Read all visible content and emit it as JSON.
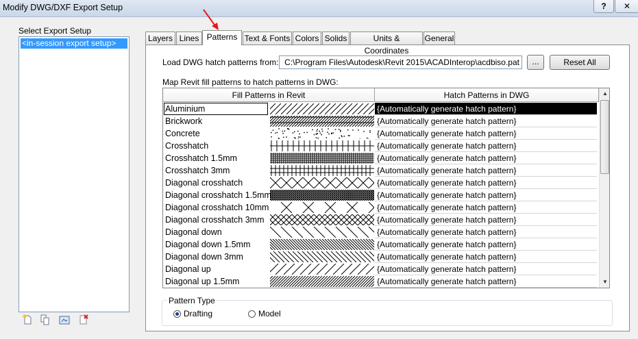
{
  "window": {
    "title": "Modify DWG/DXF Export Setup",
    "help_label": "?",
    "close_label": "✕"
  },
  "left_panel": {
    "label": "Select Export Setup",
    "items": [
      "<in-session export setup>"
    ]
  },
  "tabs": [
    "Layers",
    "Lines",
    "Patterns",
    "Text & Fonts",
    "Colors",
    "Solids",
    "Units & Coordinates",
    "General"
  ],
  "active_tab": "Patterns",
  "patterns": {
    "load_label": "Load DWG hatch patterns from:",
    "path_value": "C:\\Program Files\\Autodesk\\Revit 2015\\ACADInterop\\acdbiso.pat",
    "browse_label": "...",
    "reset_label": "Reset All",
    "map_label": "Map Revit fill patterns to hatch patterns in DWG:",
    "col_revit": "Fill Patterns in Revit",
    "col_dwg": "Hatch Patterns in DWG",
    "rows": [
      {
        "name": "Aluminium",
        "hatch": "{Automatically generate hatch pattern}",
        "pattern": "diag-up-lines"
      },
      {
        "name": "Brickwork",
        "hatch": "{Automatically generate hatch pattern}",
        "pattern": "diag-up-dense"
      },
      {
        "name": "Concrete",
        "hatch": "{Automatically generate hatch pattern}",
        "pattern": "dots"
      },
      {
        "name": "Crosshatch",
        "hatch": "{Automatically generate hatch pattern}",
        "pattern": "grid"
      },
      {
        "name": "Crosshatch 1.5mm",
        "hatch": "{Automatically generate hatch pattern}",
        "pattern": "grid-fine"
      },
      {
        "name": "Crosshatch 3mm",
        "hatch": "{Automatically generate hatch pattern}",
        "pattern": "grid-med"
      },
      {
        "name": "Diagonal crosshatch",
        "hatch": "{Automatically generate hatch pattern}",
        "pattern": "diag-cross"
      },
      {
        "name": "Diagonal crosshatch 1.5mm",
        "hatch": "{Automatically generate hatch pattern}",
        "pattern": "diag-cross-fine"
      },
      {
        "name": "Diagonal crosshatch 10mm",
        "hatch": "{Automatically generate hatch pattern}",
        "pattern": "diag-cross-wide"
      },
      {
        "name": "Diagonal crosshatch 3mm",
        "hatch": "{Automatically generate hatch pattern}",
        "pattern": "diag-cross-med"
      },
      {
        "name": "Diagonal down",
        "hatch": "{Automatically generate hatch pattern}",
        "pattern": "diag-down"
      },
      {
        "name": "Diagonal down 1.5mm",
        "hatch": "{Automatically generate hatch pattern}",
        "pattern": "diag-down-fine"
      },
      {
        "name": "Diagonal down 3mm",
        "hatch": "{Automatically generate hatch pattern}",
        "pattern": "diag-down-med"
      },
      {
        "name": "Diagonal up",
        "hatch": "{Automatically generate hatch pattern}",
        "pattern": "diag-up"
      },
      {
        "name": "Diagonal up 1.5mm",
        "hatch": "{Automatically generate hatch pattern}",
        "pattern": "diag-up-fine"
      }
    ],
    "selected_row": 0,
    "pattern_type": {
      "title": "Pattern Type",
      "options": [
        "Drafting",
        "Model"
      ],
      "selected": "Drafting"
    }
  },
  "left_tools": [
    "new-setup-icon",
    "duplicate-setup-icon",
    "rename-setup-icon",
    "delete-setup-icon"
  ],
  "colors": {
    "accent": "#3399ff",
    "arrow": "#e8181a",
    "selected_cell": "#000000"
  }
}
